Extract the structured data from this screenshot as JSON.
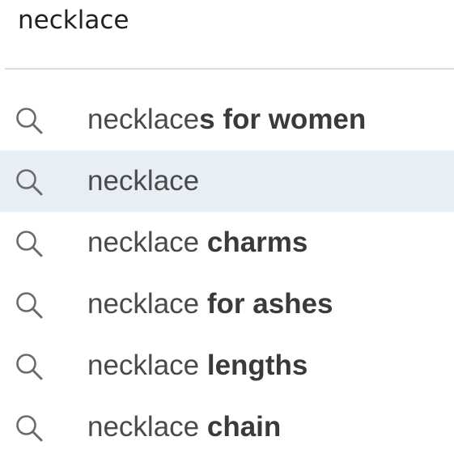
{
  "search": {
    "value": "necklace",
    "icon": "search-icon"
  },
  "suggestions": [
    {
      "prefix": "necklace",
      "completion": "s for women",
      "highlighted": false
    },
    {
      "prefix": "necklace",
      "completion": "",
      "highlighted": true
    },
    {
      "prefix": "necklace",
      "completion": " charms",
      "highlighted": false
    },
    {
      "prefix": "necklace",
      "completion": " for ashes",
      "highlighted": false
    },
    {
      "prefix": "necklace",
      "completion": " lengths",
      "highlighted": false
    },
    {
      "prefix": "necklace",
      "completion": " chain",
      "highlighted": false
    }
  ],
  "colors": {
    "highlight": "#e8eef6",
    "icon": "#6a6a6a",
    "text": "#4a4a4a"
  }
}
